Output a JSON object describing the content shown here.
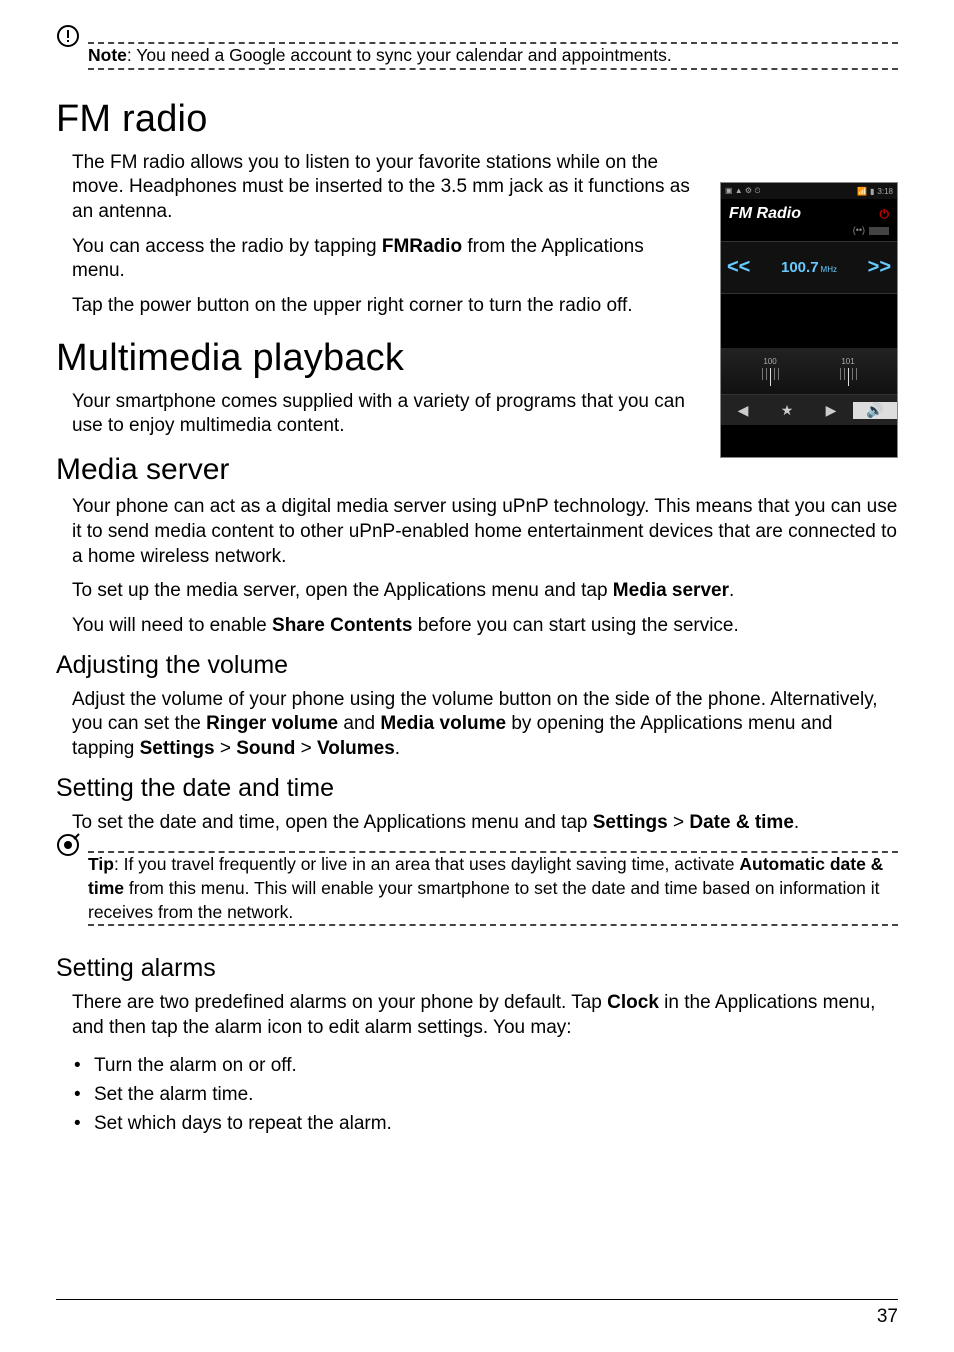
{
  "note": {
    "label": "Note",
    "text": ": You need a Google account to sync your calendar and appointments."
  },
  "fm_radio": {
    "heading": "FM radio",
    "p1": "The FM radio allows you to listen to your favorite stations while on the move. Headphones must be inserted to the 3.5 mm jack as it functions as an antenna.",
    "p2a": "You can access the radio by tapping ",
    "p2b": "FMRadio",
    "p2c": " from the Applications menu.",
    "p3": "Tap the power button on the upper right corner to turn the radio off."
  },
  "multimedia": {
    "heading": "Multimedia playback",
    "p1": "Your smartphone comes supplied with a variety of programs that you can use to enjoy multimedia content."
  },
  "media_server": {
    "heading": "Media server",
    "p1": "Your phone can act as a digital media server using uPnP technology. This means that you can use it to send media content to other uPnP-enabled home entertainment devices that are connected to a home wireless network.",
    "p2a": "To set up the media server, open the Applications menu and tap ",
    "p2b": "Media server",
    "p2c": ".",
    "p3a": "You will need to enable ",
    "p3b": "Share Contents",
    "p3c": " before you can start using the service."
  },
  "volume": {
    "heading": "Adjusting the volume",
    "p1a": "Adjust the volume of your phone using the volume button on the side of the phone. Alternatively, you can set the ",
    "p1b": "Ringer volume",
    "p1c": " and ",
    "p1d": "Media volume",
    "p1e": " by opening the Applications menu and tapping ",
    "p1f": "Settings",
    "p1g": " > ",
    "p1h": "Sound",
    "p1i": " > ",
    "p1j": "Volumes",
    "p1k": "."
  },
  "datetime": {
    "heading": "Setting the date and time",
    "p1a": "To set the date and time, open the Applications menu and tap ",
    "p1b": "Settings",
    "p1c": " > ",
    "p1d": "Date & time",
    "p1e": "."
  },
  "tip": {
    "label": "Tip",
    "t1": ": If you travel frequently or live in an area that uses daylight saving time, activate ",
    "t2": "Automatic date & time",
    "t3": " from this menu. This will enable your smartphone to set the date and time based on information it receives from the network."
  },
  "alarms": {
    "heading": "Setting alarms",
    "p1a": "There are two predefined alarms on your phone by default. Tap ",
    "p1b": "Clock",
    "p1c": " in the Applications menu, and then tap the alarm icon to edit alarm settings. You may:",
    "b1": "Turn the alarm on or off.",
    "b2": "Set the alarm time.",
    "b3": "Set which days to repeat the alarm."
  },
  "phone": {
    "title": "FM Radio",
    "status_left": "▣ ▲ ⚙ ⏲",
    "status_time": "3:18",
    "signal": "(••)",
    "arrow_left": "<<",
    "freq": "100.7",
    "mhz": "MHz",
    "arrow_right": ">>",
    "dial_a": "100",
    "dial_b": "101",
    "btn_prev": "◀",
    "btn_star": "★",
    "btn_next": "▶",
    "btn_spk": "🔊"
  },
  "page_number": "37"
}
